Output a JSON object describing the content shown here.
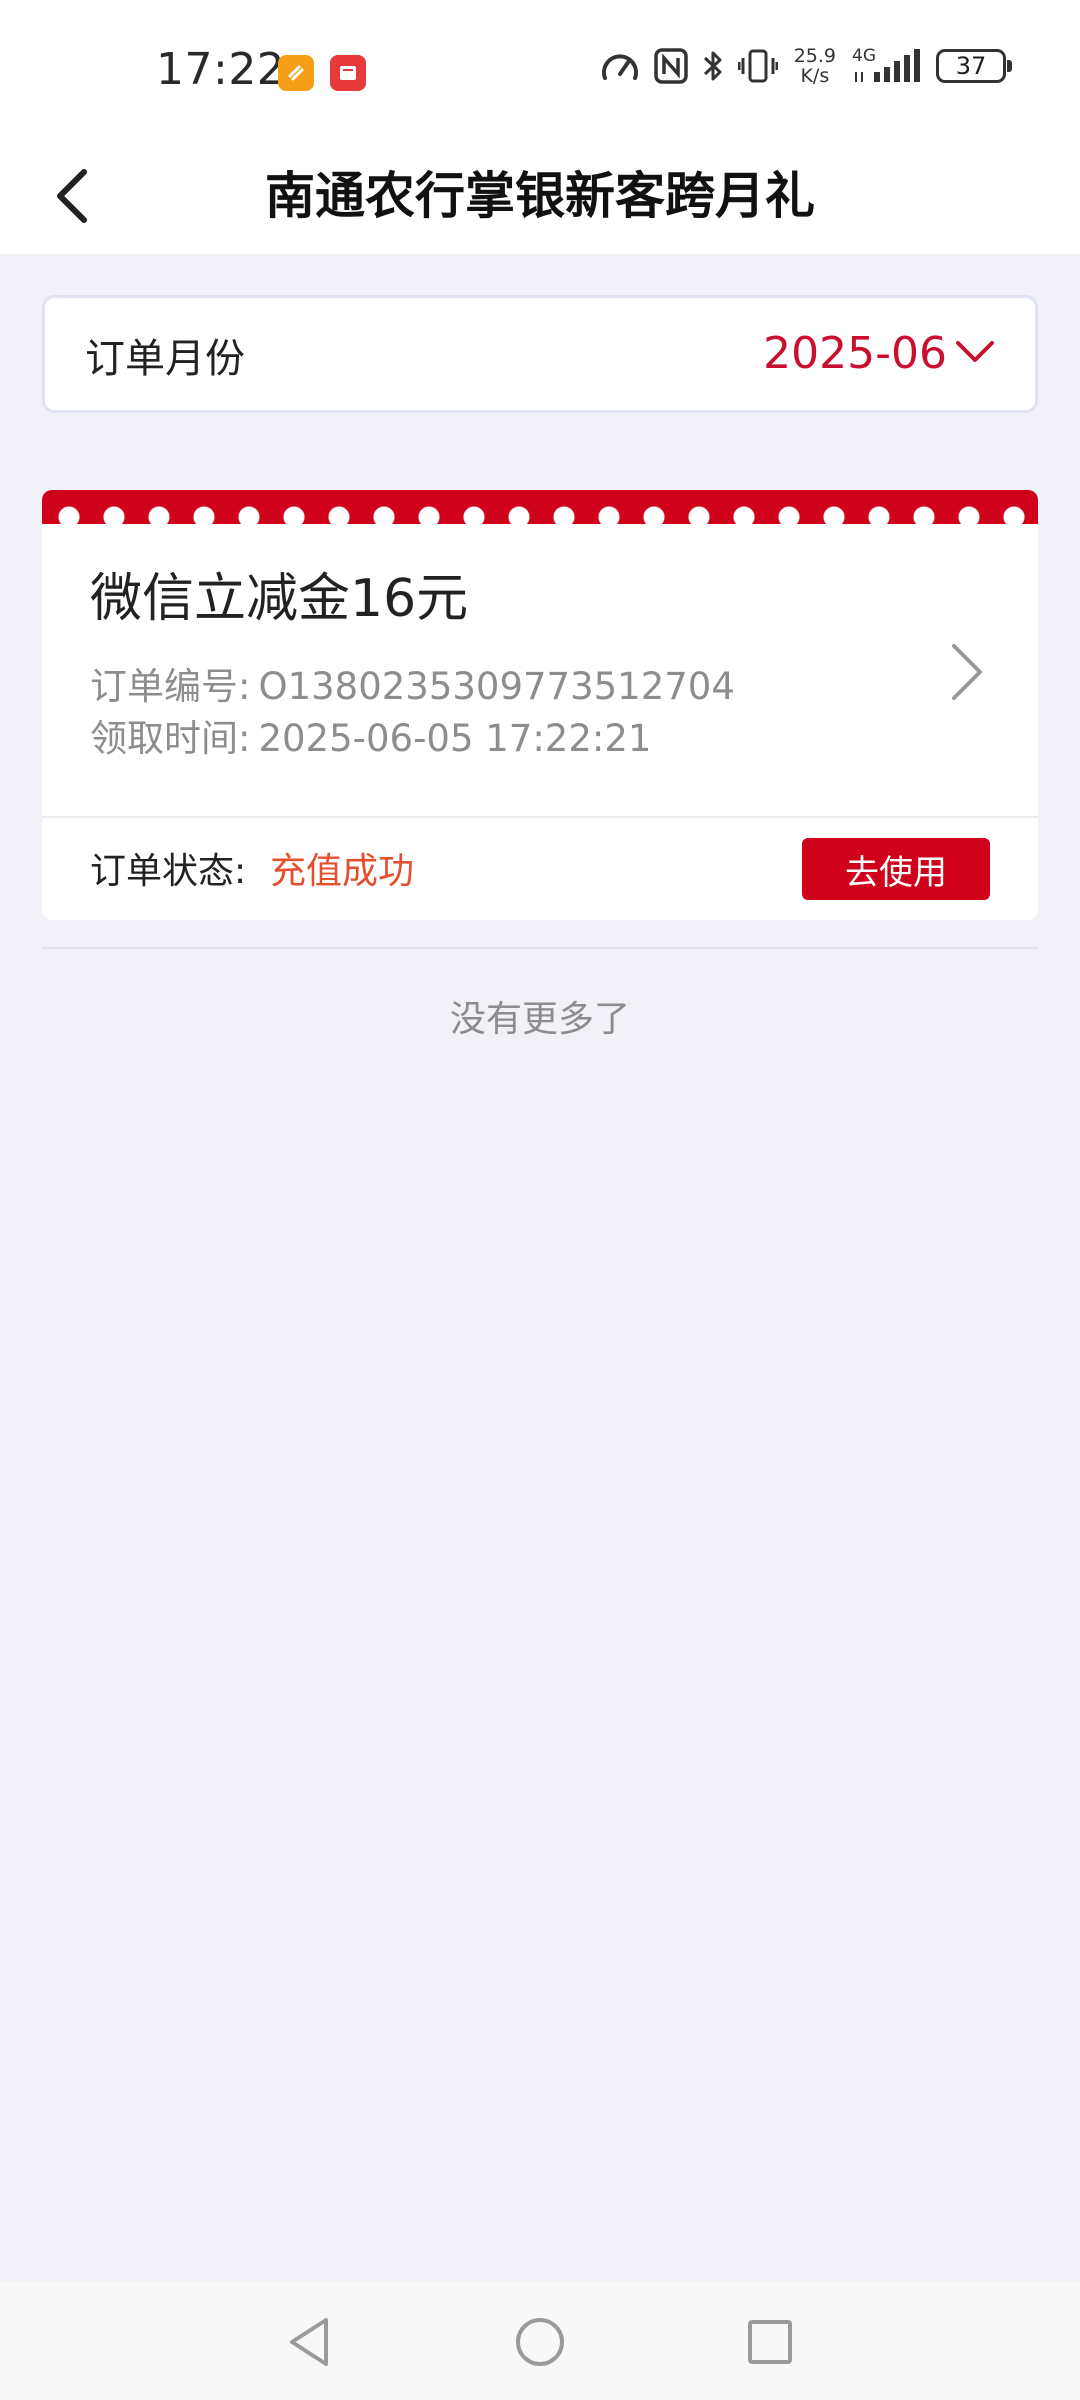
{
  "status_bar": {
    "time": "17:22",
    "net_speed_value": "25.9",
    "net_speed_unit": "K/s",
    "network_type": "4G",
    "battery_level": "37",
    "icons": [
      "app-notification-icon-orange",
      "app-notification-icon-red",
      "speedometer-icon",
      "nfc-icon",
      "bluetooth-icon",
      "vibrate-icon",
      "signal-icon"
    ]
  },
  "header": {
    "title": "南通农行掌银新客跨月礼",
    "back_icon": "chevron-left-icon"
  },
  "month_selector": {
    "label": "订单月份",
    "value": "2025-06",
    "icon": "chevron-down-icon",
    "accent_color": "#c8102e"
  },
  "orders": [
    {
      "title": "微信立减金16元",
      "order_no_label": "订单编号:",
      "order_no": "O1380235309773512704",
      "time_label": "领取时间:",
      "time": "2025-06-05 17:22:21",
      "status_label": "订单状态:",
      "status": "充值成功",
      "status_color": "#e4502e",
      "action_label": "去使用",
      "action_color": "#d0021b"
    }
  ],
  "list_footer": {
    "text": "没有更多了"
  },
  "nav_bar": {
    "icons": [
      "nav-back-icon",
      "nav-home-icon",
      "nav-recent-icon"
    ]
  }
}
